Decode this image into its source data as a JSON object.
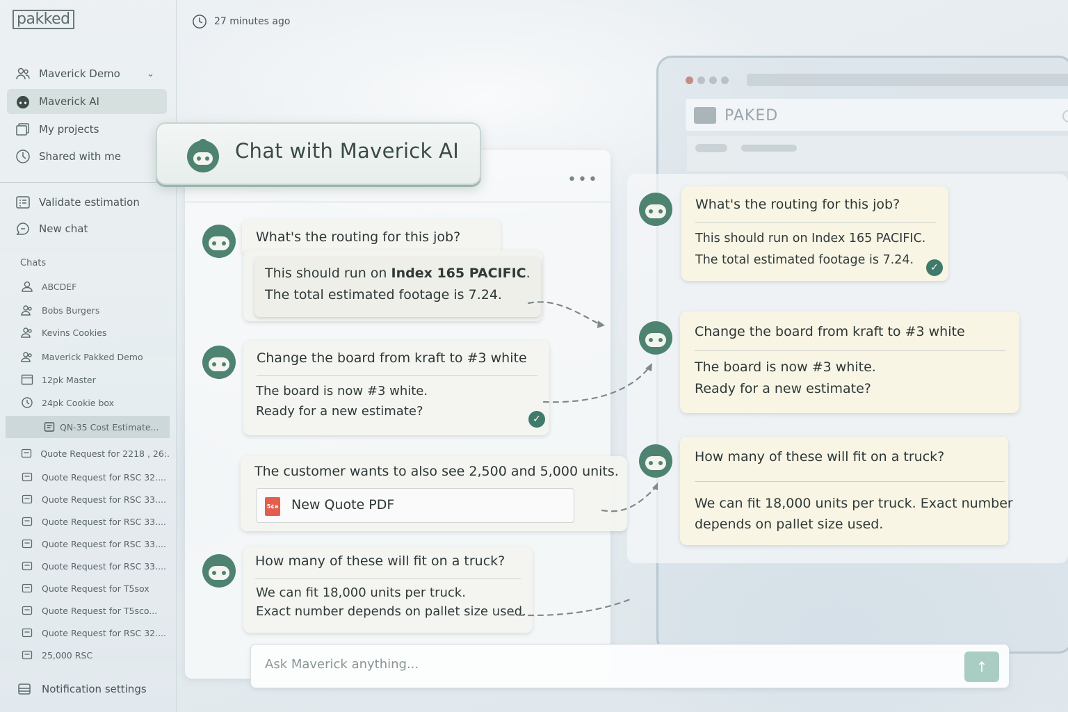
{
  "app": {
    "logo": "pakked"
  },
  "sidebar": {
    "workspace": {
      "label": "Maverick Demo",
      "icon": "users-icon"
    },
    "items": [
      {
        "label": "Maverick AI",
        "icon": "bot-icon",
        "active": true
      },
      {
        "label": "My projects",
        "icon": "folder-icon"
      },
      {
        "label": "Shared with me",
        "icon": "clock-icon"
      }
    ],
    "actions": [
      {
        "label": "Validate estimation",
        "icon": "list-icon"
      },
      {
        "label": "New chat",
        "icon": "chat-bubble-icon"
      }
    ],
    "chats_label": "Chats",
    "chats": [
      {
        "label": "ABCDEF",
        "icon": "user-icon"
      },
      {
        "label": "Bobs Burgers",
        "icon": "users-icon"
      },
      {
        "label": "Kevins Cookies",
        "icon": "users-icon"
      },
      {
        "label": "Maverick Pakked Demo",
        "icon": "users-icon"
      },
      {
        "label": "12pk Master",
        "icon": "box-icon"
      },
      {
        "label": "24pk Cookie box",
        "icon": "clock-icon"
      },
      {
        "label": "QN-35 Cost Estimate...",
        "icon": "doc-icon",
        "selected": true
      },
      {
        "label": "Quote Request for 2218 , 26:.",
        "icon": "doc-icon"
      },
      {
        "label": "Quote Request for RSC 32....",
        "icon": "doc-icon"
      },
      {
        "label": "Quote Request for RSC 33....",
        "icon": "doc-icon"
      },
      {
        "label": "Quote Request for RSC 33....",
        "icon": "doc-icon"
      },
      {
        "label": "Quote Request for RSC 33....",
        "icon": "doc-icon"
      },
      {
        "label": "Quote Request for RSC 33....",
        "icon": "doc-icon"
      },
      {
        "label": "Quote Request for T5sox",
        "icon": "doc-icon"
      },
      {
        "label": "Quote Request for T5sco...",
        "icon": "doc-icon"
      },
      {
        "label": "Quote Request for RSC 32....",
        "icon": "doc-icon"
      },
      {
        "label": "25,000 RSC",
        "icon": "doc-icon"
      }
    ],
    "notification_settings": "Notification settings"
  },
  "header": {
    "timestamp": "27 minutes ago"
  },
  "main": {
    "title": "Chat with Maverick AI",
    "menu_dots": "•••",
    "messages": [
      {
        "question": "What's the routing for this job?",
        "answer_prefix": "This should run on ",
        "answer_bold": "Index 165 PACIFIC",
        "answer_suffix": ".",
        "answer_line2": "The total estimated footage is 7.24."
      },
      {
        "question": "Change the board from kraft to #3 white",
        "answer_line1": "The board is now #3 white.",
        "answer_line2": "Ready for a new estimate?"
      },
      {
        "question": "The customer wants to also see 2,500 and 5,000 units.",
        "attachment": {
          "label": "New Quote PDF",
          "icon_text": "5¢a"
        }
      },
      {
        "question": "How many of these will fit on a truck?",
        "answer_line1": "We can fit 18,000 units per truck.",
        "answer_line2": "Exact number depends on pallet size used."
      }
    ],
    "composer": {
      "placeholder": "Ask Maverick anything..."
    }
  },
  "right": {
    "brand": "PAKED",
    "messages": [
      {
        "question": "What's the routing for this job?",
        "answer_line1": "This should run on Index 165 PACIFIC.",
        "answer_line2": "The total estimated footage is 7.24."
      },
      {
        "question": "Change the board from kraft to #3 white",
        "answer_line1": "The board is now #3 white.",
        "answer_line2": "Ready for a new estimate?"
      },
      {
        "question": "How many of these will fit on a truck?",
        "answer_line1": "We can fit 18,000 units per truck. Exact number",
        "answer_line2": "depends on pallet size used."
      }
    ]
  },
  "colors": {
    "accent": "#3f7a6a",
    "bot_green": "#4e8271",
    "send_button": "#a9cdc2",
    "pdf_red": "#e45e4e"
  }
}
